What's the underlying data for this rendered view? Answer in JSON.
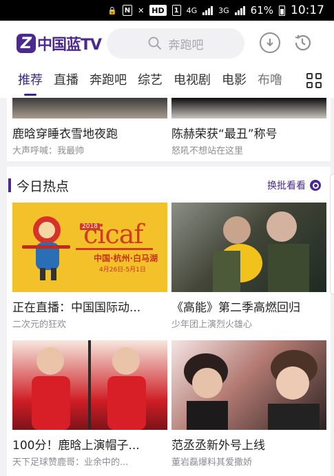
{
  "status_bar": {
    "battery": "61%",
    "time": "10:17",
    "network_4g": "4G",
    "network_3g": "3G",
    "hd_label": "HD"
  },
  "header": {
    "logo_text": "中国蓝TV",
    "search_placeholder": "奔跑吧"
  },
  "tabs": [
    "推荐",
    "直播",
    "奔跑吧",
    "综艺",
    "电视剧",
    "电影",
    "布噜"
  ],
  "feed": {
    "top_cards": [
      {
        "title": "鹿晗穿睡衣雪地夜跑",
        "subtitle": "大声呼喊：我最帅"
      },
      {
        "title": "陈赫荣获“最丑”称号",
        "subtitle": "怒吼不想站在这里"
      }
    ],
    "section": {
      "title": "今日热点",
      "more_label": "换批看看"
    },
    "hot_cards": [
      {
        "title": "正在直播：中国国际动...",
        "subtitle": "二次元的狂欢",
        "thumb": {
          "brand": "cicaf",
          "year": "2018",
          "place": "中国·杭州·白马湖",
          "date": "4月26日-5月1日"
        }
      },
      {
        "title": "《高能》第二季高燃回归",
        "subtitle": "少年团上演烈火雄心"
      },
      {
        "title": "100分！鹿晗上演帽子...",
        "subtitle": "天下足球赞鹿哥：业余中的..."
      },
      {
        "title": "范丞丞新外号上线",
        "subtitle": "董岩磊爆料其爱撒娇"
      }
    ]
  },
  "colors": {
    "brand": "#4b2a8f",
    "active_tab": "#3b2a85",
    "subtitle": "#8d8d92"
  },
  "icons": [
    "signal-icon",
    "search-icon",
    "download-icon",
    "history-icon",
    "grid-menu-icon",
    "refresh-icon"
  ]
}
